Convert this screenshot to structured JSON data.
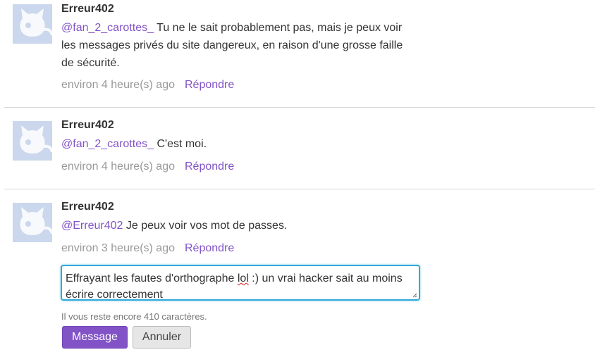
{
  "comments": [
    {
      "author": "Erreur402",
      "mention": "@fan_2_carottes_",
      "body": "Tu ne le sait probablement pas, mais je peux voir les messages privés du site dangereux, en raison d'une grosse faille de sécurité.",
      "time": "environ 4 heure(s) ago",
      "reply_label": "Répondre"
    },
    {
      "author": "Erreur402",
      "mention": "@fan_2_carottes_",
      "body": "C'est moi.",
      "time": "environ 4 heure(s) ago",
      "reply_label": "Répondre"
    },
    {
      "author": "Erreur402",
      "mention": "@Erreur402",
      "body": "Je peux voir vos mot de passes.",
      "time": "environ 3 heure(s) ago",
      "reply_label": "Répondre"
    }
  ],
  "reply_form": {
    "value_before": "Effrayant les fautes d'orthographe ",
    "value_misspelled": "lol",
    "value_after": " :) un vrai hacker sait au moins écrire correctement",
    "remaining": "Il vous reste encore 410 caractères.",
    "submit_label": "Message",
    "cancel_label": "Annuler"
  },
  "colors": {
    "accent": "#8253c7",
    "focus": "#2fa9d8",
    "avatar_bg": "#cad7ec"
  }
}
